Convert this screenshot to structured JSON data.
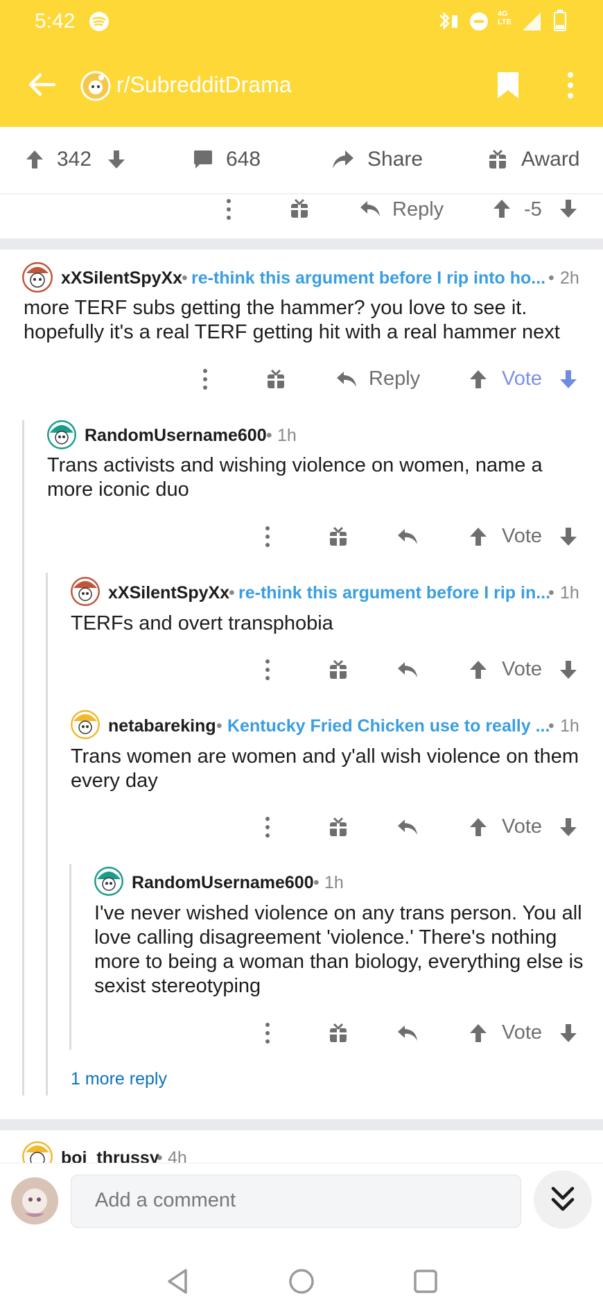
{
  "status_bar": {
    "time": "5:42",
    "network": "4G LTE"
  },
  "app_bar": {
    "subreddit": "r/SubredditDrama"
  },
  "post_actions": {
    "upvotes": "342",
    "comments": "648",
    "share_label": "Share",
    "award_label": "Award"
  },
  "prev_comment_actions": {
    "reply_label": "Reply",
    "score": "-5"
  },
  "comments": [
    {
      "user": "xXSilentSpyXx",
      "flair": "re-think this argument before I rip into ho...",
      "age": "2h",
      "body": "more TERF subs getting the hammer? you love to see it. hopefully it's a real TERF getting hit with a real hammer next",
      "reply_label": "Reply",
      "vote_label": "Vote"
    },
    {
      "user": "RandomUsername600",
      "flair": "",
      "age": "1h",
      "body": "Trans activists and wishing violence on women, name a more iconic duo",
      "vote_label": "Vote"
    },
    {
      "user": "xXSilentSpyXx",
      "flair": "re-think this argument before I rip in...",
      "age": "1h",
      "body": "TERFs and overt transphobia",
      "vote_label": "Vote"
    },
    {
      "user": "netabareking",
      "flair": "Kentucky Fried Chicken use to really ...",
      "age": "1h",
      "body": "Trans women are women and y'all wish violence on them every day",
      "vote_label": "Vote"
    },
    {
      "user": "RandomUsername600",
      "flair": "",
      "age": "1h",
      "body": "I've never wished violence on any trans person. You all love calling disagreement 'violence.' There's nothing more to being a woman than biology, everything else is sexist stereotyping",
      "vote_label": "Vote"
    }
  ],
  "more_reply": "1 more reply",
  "next_comment": {
    "user": "boi_thrussy",
    "age": "4h"
  },
  "composer": {
    "placeholder": "Add a comment"
  },
  "colors": {
    "app_bar": "#fed836",
    "flair_blue": "#3a9ee0",
    "link_blue": "#0a73b8",
    "downvote_blue": "#7d8ee6"
  }
}
